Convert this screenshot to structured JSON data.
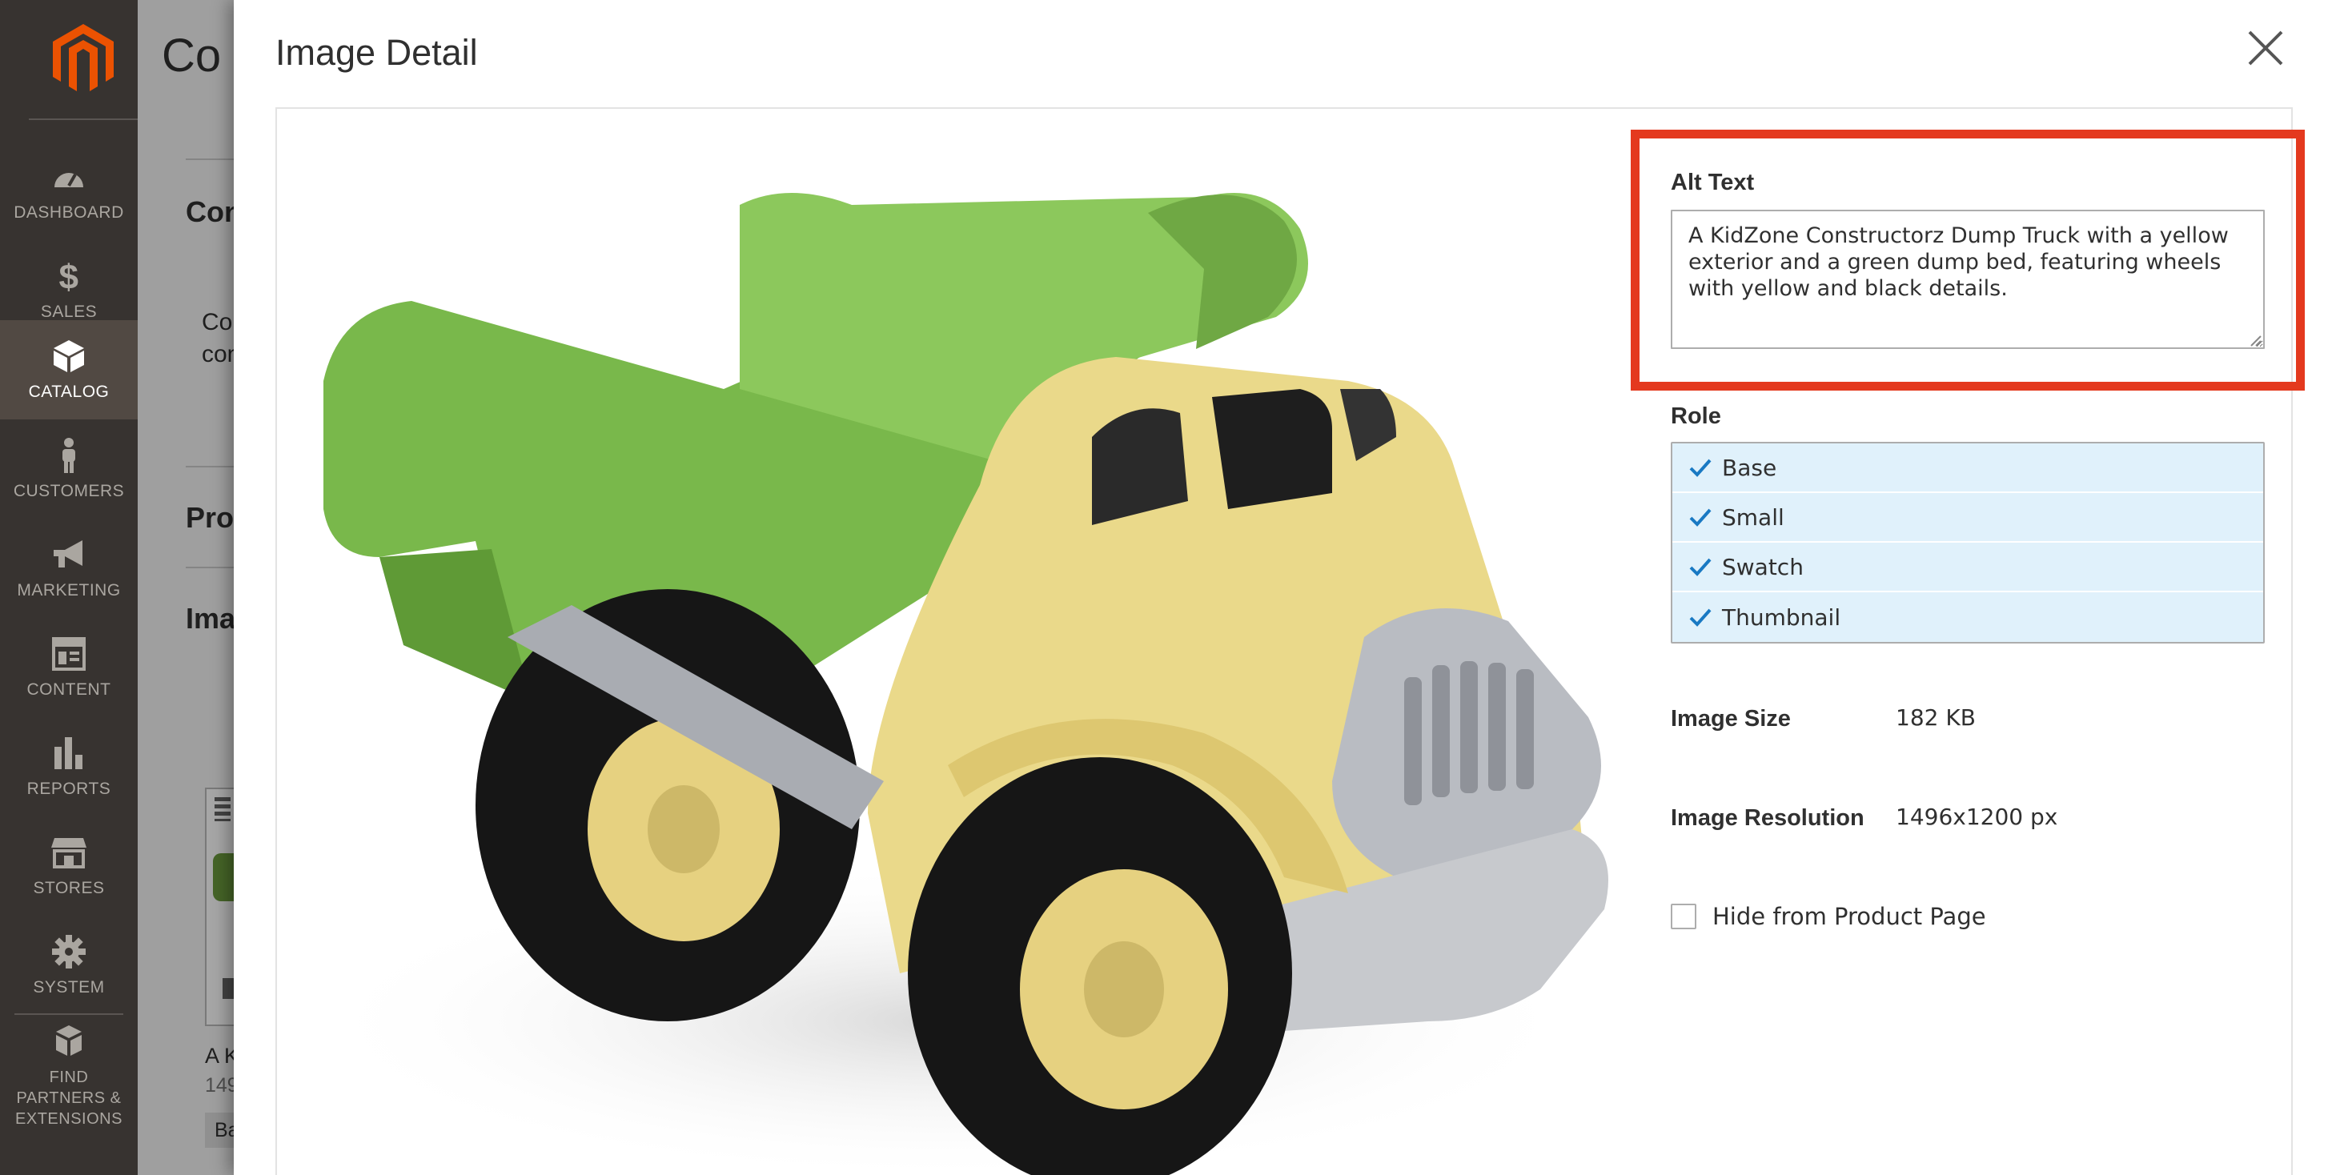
{
  "sidebar": {
    "items": [
      {
        "label": "Dashboard",
        "icon": "dashboard-icon"
      },
      {
        "label": "Sales",
        "icon": "dollar-icon"
      },
      {
        "label": "Catalog",
        "icon": "box-icon"
      },
      {
        "label": "Customers",
        "icon": "person-icon"
      },
      {
        "label": "Marketing",
        "icon": "megaphone-icon"
      },
      {
        "label": "Content",
        "icon": "layout-icon"
      },
      {
        "label": "Reports",
        "icon": "bar-chart-icon"
      },
      {
        "label": "Stores",
        "icon": "storefront-icon"
      },
      {
        "label": "System",
        "icon": "gear-icon"
      },
      {
        "label": "Find Partners & Extensions",
        "icon": "cubes-icon"
      }
    ],
    "active": "Catalog"
  },
  "background_page": {
    "title_fragment": "Co",
    "section1_fragment": "Con",
    "para_fragment_1": "Con",
    "para_fragment_2": "con",
    "section2_fragment": "Pro",
    "section3_fragment": "Ima",
    "caption_fragment_1": "A K",
    "caption_fragment_2": "149",
    "tag_fragment": "Ba"
  },
  "modal": {
    "title": "Image Detail",
    "alt_text": {
      "label": "Alt Text",
      "value": "A KidZone Constructorz Dump Truck with a yellow exterior and a green dump bed, featuring wheels with yellow and black details."
    },
    "role": {
      "label": "Role",
      "options": [
        {
          "label": "Base",
          "selected": true
        },
        {
          "label": "Small",
          "selected": true
        },
        {
          "label": "Swatch",
          "selected": true
        },
        {
          "label": "Thumbnail",
          "selected": true
        }
      ]
    },
    "image_size": {
      "label": "Image Size",
      "value": "182 KB"
    },
    "image_resolution": {
      "label": "Image Resolution",
      "value": "1496x1200 px"
    },
    "hide_from_product_page": {
      "label": "Hide from Product Page",
      "checked": false
    }
  },
  "colors": {
    "sidebar_bg": "#373330",
    "sidebar_active": "#514943",
    "highlight_border": "#e4391e",
    "role_selected_bg": "#e0f1fb",
    "check_color": "#1979c3"
  }
}
